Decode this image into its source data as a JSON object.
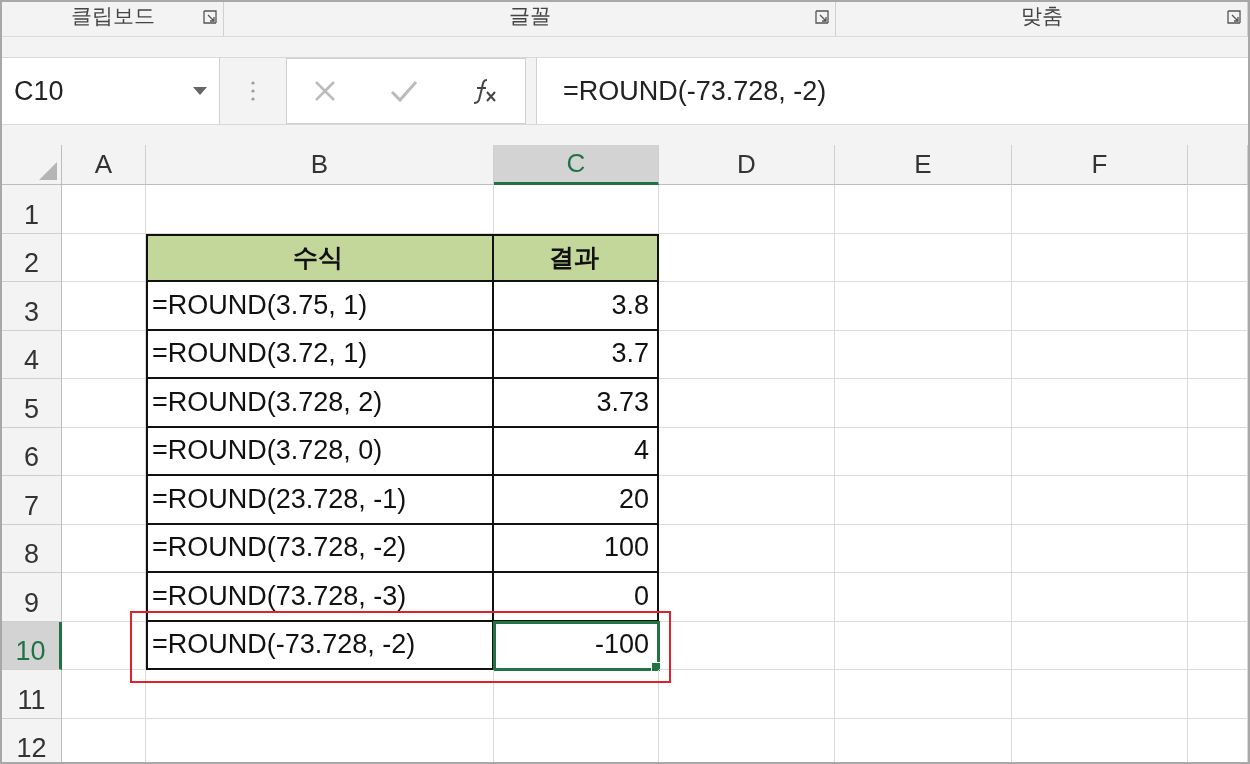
{
  "ribbon_groups": [
    {
      "label": "클립보드"
    },
    {
      "label": "글꼴"
    },
    {
      "label": "맞춤"
    }
  ],
  "name_box": {
    "value": "C10"
  },
  "formula_bar": {
    "value": "=ROUND(-73.728, -2)"
  },
  "sheet": {
    "columns": [
      {
        "label": "A",
        "selected": false
      },
      {
        "label": "B",
        "selected": false
      },
      {
        "label": "C",
        "selected": true
      },
      {
        "label": "D",
        "selected": false
      },
      {
        "label": "E",
        "selected": false
      },
      {
        "label": "F",
        "selected": false
      }
    ],
    "rows": [
      {
        "number": "1",
        "selected": false,
        "kind": "empty"
      },
      {
        "number": "2",
        "selected": false,
        "kind": "header",
        "formula": "수식",
        "result": "결과"
      },
      {
        "number": "3",
        "selected": false,
        "kind": "data",
        "highlighted": false,
        "formula": "=ROUND(3.75, 1)",
        "result": "3.8"
      },
      {
        "number": "4",
        "selected": false,
        "kind": "data",
        "highlighted": false,
        "formula": "=ROUND(3.72, 1)",
        "result": "3.7"
      },
      {
        "number": "5",
        "selected": false,
        "kind": "data",
        "highlighted": false,
        "formula": "=ROUND(3.728, 2)",
        "result": "3.73"
      },
      {
        "number": "6",
        "selected": false,
        "kind": "data",
        "highlighted": false,
        "formula": "=ROUND(3.728, 0)",
        "result": "4"
      },
      {
        "number": "7",
        "selected": false,
        "kind": "data",
        "highlighted": false,
        "formula": "=ROUND(23.728, -1)",
        "result": "20"
      },
      {
        "number": "8",
        "selected": false,
        "kind": "data",
        "highlighted": false,
        "formula": "=ROUND(73.728, -2)",
        "result": "100"
      },
      {
        "number": "9",
        "selected": false,
        "kind": "data",
        "highlighted": false,
        "formula": "=ROUND(73.728, -3)",
        "result": "0"
      },
      {
        "number": "10",
        "selected": true,
        "kind": "data",
        "highlighted": true,
        "formula": "=ROUND(-73.728, -2)",
        "result": "-100"
      },
      {
        "number": "11",
        "selected": false,
        "kind": "empty"
      },
      {
        "number": "12",
        "selected": false,
        "kind": "empty"
      }
    ]
  }
}
